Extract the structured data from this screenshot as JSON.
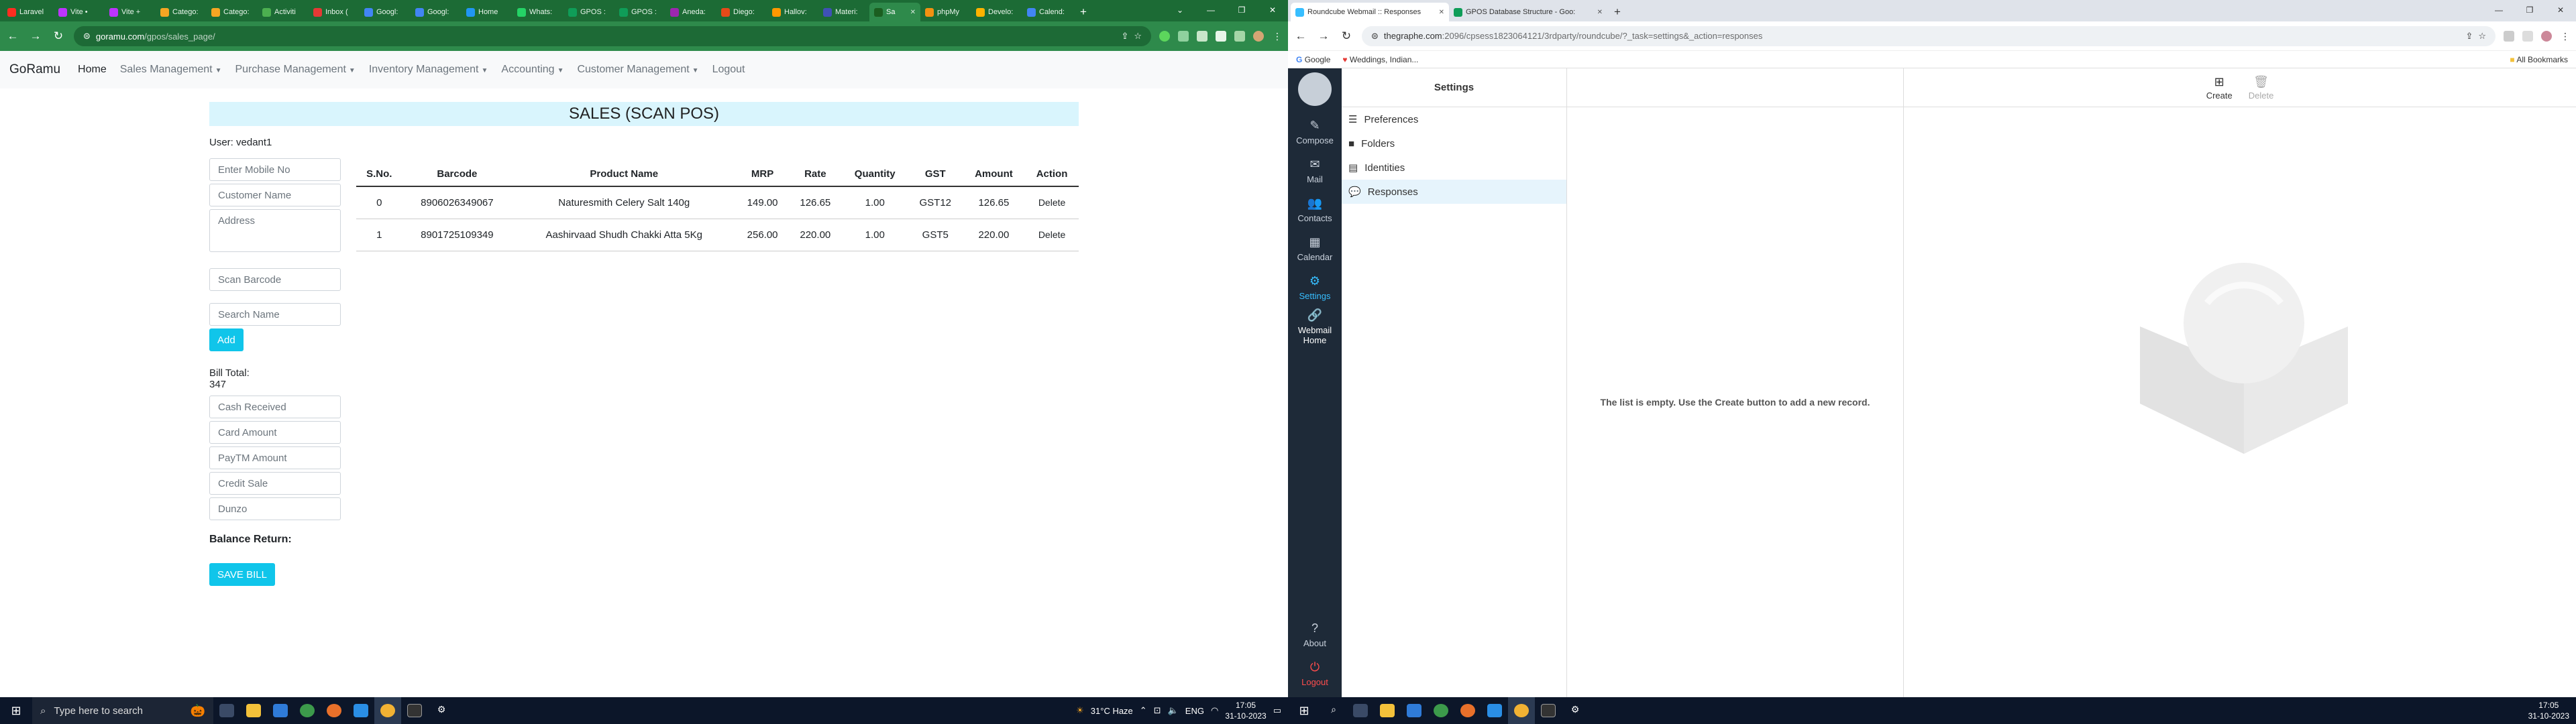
{
  "left_browser": {
    "tabs": [
      {
        "label": "Laravel",
        "color": "#ff2d20"
      },
      {
        "label": "Vite •",
        "color": "#bd34fe"
      },
      {
        "label": "Vite +",
        "color": "#bd34fe"
      },
      {
        "label": "Catego:",
        "color": "#f5a623"
      },
      {
        "label": "Catego:",
        "color": "#f5a623"
      },
      {
        "label": "Activiti",
        "color": "#4caf50"
      },
      {
        "label": "Inbox (",
        "color": "#e53935"
      },
      {
        "label": "Googl:",
        "color": "#4285f4"
      },
      {
        "label": "Googl:",
        "color": "#4285f4"
      },
      {
        "label": "Home",
        "color": "#2196f3"
      },
      {
        "label": "Whats:",
        "color": "#25d366"
      },
      {
        "label": "GPOS :",
        "color": "#0f9d58"
      },
      {
        "label": "GPOS :",
        "color": "#0f9d58"
      },
      {
        "label": "Aneda:",
        "color": "#9c27b0"
      },
      {
        "label": "Diego:",
        "color": "#e64a19"
      },
      {
        "label": "Hallov:",
        "color": "#ff9800"
      },
      {
        "label": "Materi:",
        "color": "#3f51b5"
      },
      {
        "label": "Sa",
        "color": "#1b5e20",
        "active": true
      },
      {
        "label": "phpMy",
        "color": "#f29111"
      },
      {
        "label": "Develo:",
        "color": "#ffb300"
      },
      {
        "label": "Calend:",
        "color": "#4285f4"
      }
    ],
    "url_host": "goramu.com",
    "url_path": "/gpos/sales_page/"
  },
  "left_app": {
    "brand": "GoRamu",
    "nav": [
      {
        "label": "Home",
        "active": true,
        "dropdown": false
      },
      {
        "label": "Sales Management",
        "dropdown": true
      },
      {
        "label": "Purchase Management",
        "dropdown": true
      },
      {
        "label": "Inventory Management",
        "dropdown": true
      },
      {
        "label": "Accounting",
        "dropdown": true
      },
      {
        "label": "Customer Management",
        "dropdown": true
      },
      {
        "label": "Logout",
        "dropdown": false
      }
    ],
    "title": "SALES (SCAN POS)",
    "user_label": "User: vedant1",
    "placeholders": {
      "mobile": "Enter Mobile No",
      "customer": "Customer Name",
      "address": "Address",
      "barcode": "Scan Barcode",
      "search": "Search Name",
      "cash": "Cash Received",
      "card": "Card Amount",
      "paytm": "PayTM Amount",
      "credit": "Credit Sale",
      "dunzo": "Dunzo"
    },
    "add_label": "Add",
    "bill_total_label": "Bill Total:",
    "bill_total_value": "347",
    "balance_label": "Balance Return:",
    "save_label": "SAVE BILL",
    "table": {
      "headers": [
        "S.No.",
        "Barcode",
        "Product Name",
        "MRP",
        "Rate",
        "Quantity",
        "GST",
        "Amount",
        "Action"
      ],
      "rows": [
        [
          "0",
          "8906026349067",
          "Naturesmith Celery Salt 140g",
          "149.00",
          "126.65",
          "1.00",
          "GST12",
          "126.65",
          "Delete"
        ],
        [
          "1",
          "8901725109349",
          "Aashirvaad Shudh Chakki Atta 5Kg",
          "256.00",
          "220.00",
          "1.00",
          "GST5",
          "220.00",
          "Delete"
        ]
      ]
    }
  },
  "left_taskbar": {
    "search": "Type here to search",
    "weather": "31°C  Haze",
    "lang": "ENG",
    "time": "17:05",
    "date": "31-10-2023"
  },
  "right_browser": {
    "tabs": [
      {
        "label": "Roundcube Webmail :: Responses",
        "color": "#37beff",
        "active": true
      },
      {
        "label": "GPOS Database Structure - Goo:",
        "color": "#0f9d58"
      }
    ],
    "url_host": "thegraphe.com",
    "url_path": ":2096/cpsess1823064121/3rdparty/roundcube/?_task=settings&_action=responses",
    "bookmarks": [
      "Google",
      "Weddings, Indian..."
    ],
    "all_bookmarks": "All Bookmarks"
  },
  "roundcube": {
    "nav": [
      {
        "label": "Compose",
        "icon": "✎",
        "name": "compose"
      },
      {
        "label": "Mail",
        "icon": "✉",
        "name": "mail"
      },
      {
        "label": "Contacts",
        "icon": "👥",
        "name": "contacts"
      },
      {
        "label": "Calendar",
        "icon": "▦",
        "name": "calendar"
      },
      {
        "label": "Settings",
        "icon": "⚙",
        "name": "settings",
        "selected": true
      },
      {
        "label": "Webmail Home",
        "icon": "🔗",
        "name": "webmail-home",
        "home": true
      }
    ],
    "about": "About",
    "logout": "Logout",
    "settings_title": "Settings",
    "settings_items": [
      {
        "label": "Preferences",
        "icon": "☰",
        "name": "preferences"
      },
      {
        "label": "Folders",
        "icon": "■",
        "name": "folders"
      },
      {
        "label": "Identities",
        "icon": "▤",
        "name": "identities"
      },
      {
        "label": "Responses",
        "icon": "💬",
        "name": "responses",
        "selected": true
      }
    ],
    "empty_message": "The list is empty. Use the Create button to add a new record.",
    "create_label": "Create",
    "delete_label": "Delete"
  },
  "right_taskbar": {
    "time": "17:05",
    "date": "31-10-2023"
  }
}
